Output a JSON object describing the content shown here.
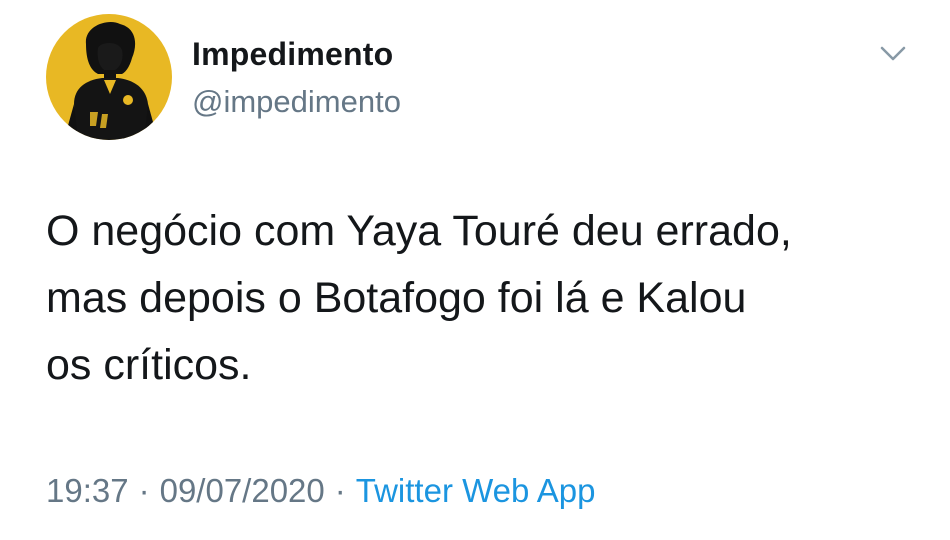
{
  "user": {
    "display_name": "Impedimento",
    "handle": "@impedimento",
    "avatar_icon": "player-silhouette-avatar",
    "avatar_bg": "#e8b824"
  },
  "tweet": {
    "text": "O negócio com Yaya Touré deu errado,\nmas depois o Botafogo foi lá e Kalou\nos críticos."
  },
  "meta": {
    "time": "19:37",
    "separator": "·",
    "date": "09/07/2020",
    "source": "Twitter Web App"
  },
  "menu": {
    "icon": "chevron-down-icon"
  },
  "colors": {
    "text": "#14171a",
    "secondary": "#657786",
    "link": "#1b95e0"
  }
}
